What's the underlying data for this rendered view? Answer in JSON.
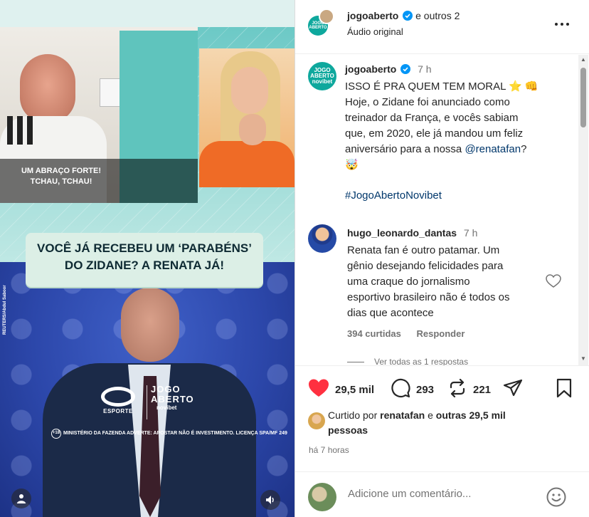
{
  "media": {
    "clip_caption": [
      "UM ABRAÇO FORTE!",
      "TCHAU, TCHAU!"
    ],
    "title_lines": [
      "VOCÊ JÁ RECEBEU UM ‘PARABÉNS’",
      "DO ZIDANE? A RENATA JÁ!"
    ],
    "photo_credit": "REUTERS/Abdul Saboor",
    "broadcaster": "ESPORTE",
    "show_logo": [
      "JOGO",
      "ABERTO"
    ],
    "show_sponsor": "novibet",
    "age_rating": "+18",
    "disclaimer": "MINISTÉRIO DA FAZENDA ADVERTE: APOSTAR NÃO É INVESTIMENTO. LICENÇA SPA/MF 249",
    "icons": {
      "tagged_users": "person-icon",
      "audio": "speaker-icon"
    }
  },
  "header": {
    "username": "jogoaberto",
    "others": "e outros 2",
    "audio": "Áudio original",
    "avatar_text": [
      "JOGO",
      "ABERTO",
      "novibet"
    ]
  },
  "caption": {
    "username": "jogoaberto",
    "time": "7 h",
    "lines": [
      "ISSO É PRA QUEM TEM MORAL ⭐ 👊",
      "Hoje, o Zidane foi anunciado como",
      "treinador da França, e vocês sabiam",
      "que, em 2020, ele já mandou um feliz",
      "aniversário para a nossa"
    ],
    "mention": "@renatafan",
    "mention_suffix": "?",
    "emoji_line": "🤯",
    "hashtag": "#JogoAbertoNovibet"
  },
  "comment": {
    "username": "hugo_leonardo_dantas",
    "time": "7 h",
    "lines": [
      "Renata fan é outro patamar. Um",
      "gênio desejando felicidades para",
      "uma craque do jornalismo",
      "esportivo brasileiro não é todos os",
      "dias que acontece"
    ],
    "likes": "394 curtidas",
    "reply": "Responder",
    "view_replies": "Ver todas as 1 respostas"
  },
  "actions": {
    "likes": "29,5 mil",
    "comments": "293",
    "shares": "221"
  },
  "liked_by": {
    "prefix": "Curtido por",
    "user": "renatafan",
    "mid": "e",
    "others": "outras 29,5 mil",
    "suffix": "pessoas"
  },
  "timestamp": "há 7 horas",
  "composer": {
    "placeholder": "Adicione um comentário..."
  },
  "colors": {
    "brand_teal": "#0ea89d",
    "like_red": "#ff3040",
    "link_blue": "#00376b",
    "verified_blue": "#0095f6"
  }
}
